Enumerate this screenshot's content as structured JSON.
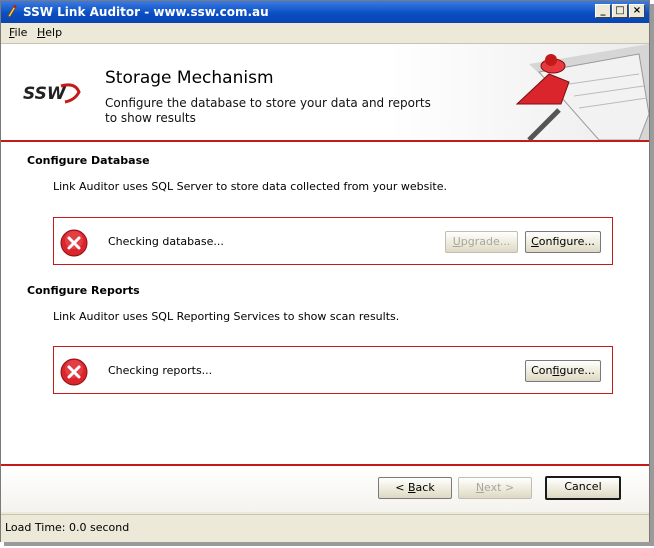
{
  "window": {
    "title": "SSW Link Auditor - www.ssw.com.au",
    "controls": {
      "minimize": "_",
      "maximize": "□",
      "close": "×"
    }
  },
  "menu": {
    "file": {
      "accel": "F",
      "rest": "ile"
    },
    "help": {
      "accel": "H",
      "rest": "elp"
    }
  },
  "header": {
    "logo_text": "SSW",
    "title": "Storage Mechanism",
    "subtitle": "Configure the database to store your data and reports to show results"
  },
  "database": {
    "section_title": "Configure Database",
    "description": "Link Auditor uses SQL Server to store data collected from your website.",
    "status_text": "Checking database...",
    "upgrade_button": {
      "accel": "U",
      "rest": "pgrade..."
    },
    "configure_button": {
      "accel": "C",
      "rest": "onfigure..."
    }
  },
  "reports": {
    "section_title": "Configure Reports",
    "description": "Link Auditor uses SQL Reporting Services to show scan results.",
    "status_text": "Checking reports...",
    "configure_button": {
      "pre": "Con",
      "accel": "f",
      "rest": "igure..."
    }
  },
  "footer": {
    "back_button": {
      "pre": "< ",
      "accel": "B",
      "rest": "ack"
    },
    "next_button": {
      "accel": "N",
      "rest": "ext >"
    },
    "cancel_button": "Cancel"
  },
  "statusbar": {
    "text": "Load Time: 0.0 second"
  },
  "colors": {
    "accent_red": "#c41a1a",
    "title_blue": "#0a4fc4"
  },
  "icons": [
    "app-icon",
    "error-icon",
    "clipboard-illustration"
  ]
}
